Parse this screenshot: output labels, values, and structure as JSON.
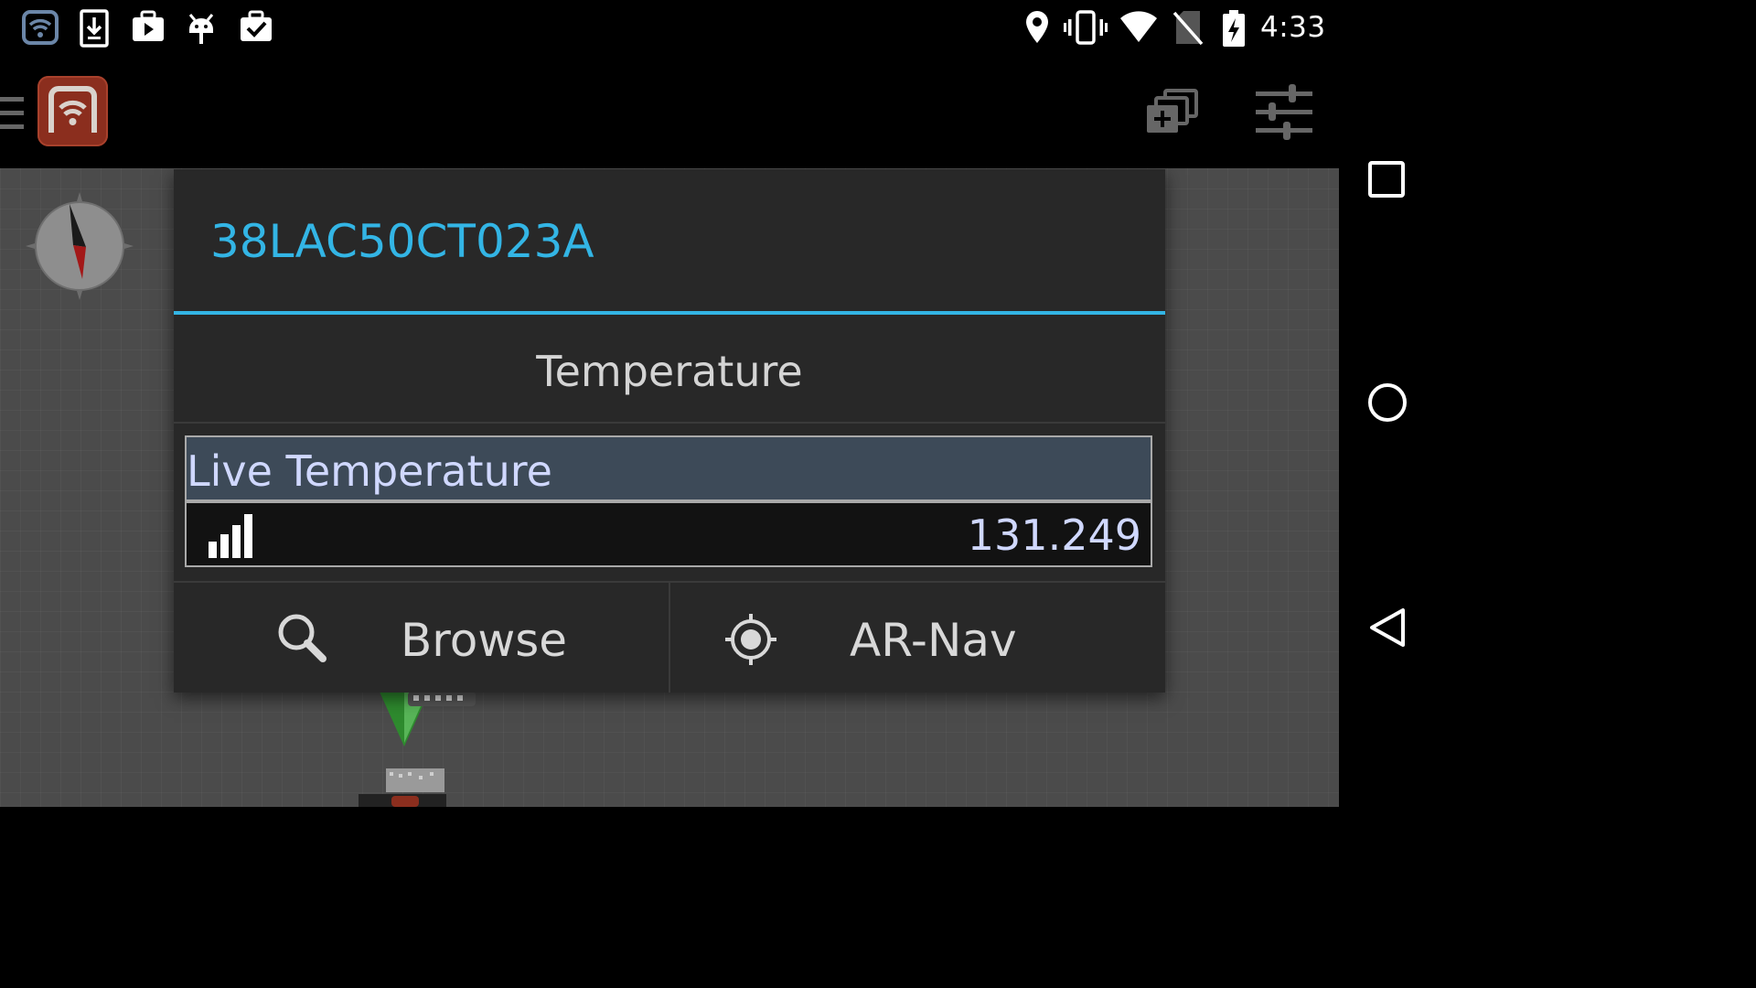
{
  "status_bar": {
    "time": "4:33",
    "left_icons": [
      "wifi-app-notification-icon",
      "download-icon",
      "media-briefcase-icon",
      "android-debug-icon",
      "task-check-icon"
    ],
    "right_icons": [
      "location-pin-icon",
      "vibrate-icon",
      "wifi-signal-icon",
      "no-sim-icon",
      "battery-charging-icon"
    ]
  },
  "action_bar": {
    "icons": [
      "menu-icon",
      "app-logo-icon",
      "add-layer-icon",
      "tune-settings-icon"
    ]
  },
  "dialog": {
    "title": "38LAC50CT023A",
    "section_title": "Temperature",
    "sensor": {
      "label": "Live Temperature",
      "value": "131.249",
      "icon": "signal-bars-icon"
    },
    "buttons": {
      "browse_label": "Browse",
      "arnav_label": "AR-Nav"
    }
  },
  "nav_bar": {
    "icons": [
      "recents-icon",
      "home-icon",
      "back-icon"
    ]
  },
  "colors": {
    "accent": "#33b5e5",
    "dialog_bg": "#282828",
    "map_bg": "#4b4b4b",
    "sensor_header_bg": "#3d4a58",
    "sensor_text": "#d0d8ff"
  }
}
